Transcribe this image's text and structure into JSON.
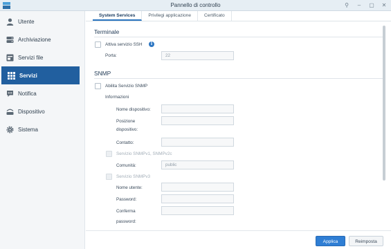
{
  "window": {
    "title": "Pannello di controllo",
    "controls": [
      "pin-icon",
      "minimize-icon",
      "maximize-icon",
      "close-icon"
    ]
  },
  "sidebar": {
    "items": [
      {
        "label": "Utente",
        "icon": "user-icon",
        "active": false
      },
      {
        "label": "Archiviazione",
        "icon": "storage-icon",
        "active": false
      },
      {
        "label": "Servizi file",
        "icon": "file-services-icon",
        "active": false
      },
      {
        "label": "Servizi",
        "icon": "services-grid-icon",
        "active": true
      },
      {
        "label": "Notifica",
        "icon": "notification-icon",
        "active": false
      },
      {
        "label": "Dispositivo",
        "icon": "device-icon",
        "active": false
      },
      {
        "label": "Sistema",
        "icon": "gear-icon",
        "active": false
      }
    ]
  },
  "tabs": [
    {
      "label": "System Services",
      "active": true
    },
    {
      "label": "Privilegi applicazione",
      "active": false
    },
    {
      "label": "Certificato",
      "active": false
    }
  ],
  "terminal": {
    "heading": "Terminale",
    "ssh_label": "Attiva servizio SSH",
    "port_label": "Porta:",
    "port_value": "22"
  },
  "snmp": {
    "heading": "SNMP",
    "enable_label": "Abilita Servizio SNMP",
    "info_label": "Informazioni",
    "device_name_label": "Nome dispositivo:",
    "device_position_label_1": "Posizione",
    "device_position_label_2": "dispositivo:",
    "contact_label": "Contatto:",
    "v1v2_label": "Servizio SNMPv1, SNMPv2c",
    "community_label": "Comunità:",
    "community_value": "public",
    "v3_label": "Servizio SNMPv3",
    "username_label": "Nome utente:",
    "password_label": "Password:",
    "confirm_label_1": "Conferma",
    "confirm_label_2": "password:"
  },
  "footer": {
    "apply_label": "Applica",
    "reset_label": "Reimposta"
  },
  "colors": {
    "accent": "#215f9f",
    "apply": "#2f7ed4",
    "info": "#2d76c2"
  }
}
